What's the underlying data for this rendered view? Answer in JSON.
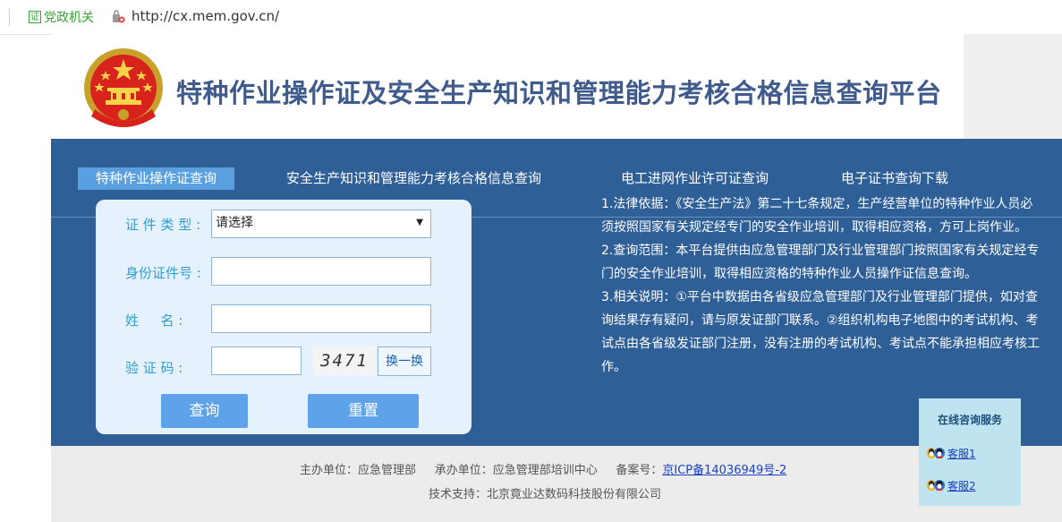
{
  "browser": {
    "badge_icon_char": "证",
    "badge_label": "党政机关",
    "url": "http://cx.mem.gov.cn/"
  },
  "header": {
    "title": "特种作业操作证及安全生产知识和管理能力考核合格信息查询平台"
  },
  "tabs": [
    {
      "label": "特种作业操作证查询",
      "active": true
    },
    {
      "label": "安全生产知识和管理能力考核合格信息查询",
      "active": false
    },
    {
      "label": "电工进网作业许可证查询",
      "active": false
    },
    {
      "label": "电子证书查询下载",
      "active": false
    }
  ],
  "form": {
    "cert_type_label": "证 件 类 型 :",
    "cert_type_value": "请选择",
    "id_label": "身份证件号 :",
    "id_value": "",
    "name_label": "姓 　 名 :",
    "name_value": "",
    "captcha_label": "验 证 码 :",
    "captcha_value": "",
    "captcha_image_text": "3471",
    "refresh_label": "换一换",
    "query_button": "查询",
    "reset_button": "重置"
  },
  "info": {
    "p1": "1.法律依据：《安全生产法》第二十七条规定，生产经营单位的特种作业人员必须按照国家有关规定经专门的安全作业培训，取得相应资格，方可上岗作业。",
    "p2": "2.查询范围：本平台提供由应急管理部门及行业管理部门按照国家有关规定经专门的安全作业培训，取得相应资格的特种作业人员操作证信息查询。",
    "p3": "3.相关说明：①平台中数据由各省级应急管理部门及行业管理部门提供，如对查询结果存有疑问，请与原发证部门联系。②组织机构电子地图中的考试机构、考试点由各省级发证部门注册，没有注册的考试机构、考试点不能承担相应考核工作。"
  },
  "footer": {
    "sponsor": "主办单位：应急管理部",
    "organizer": "承办单位：应急管理部培训中心",
    "icp_label": "备案号：",
    "icp_link": "京ICP备14036949号-2",
    "tech_support": "技术支持：北京竟业达数码科技股份有限公司"
  },
  "service": {
    "title": "在线咨询服务",
    "items": [
      "客服1",
      "客服2"
    ]
  },
  "colors": {
    "panel_blue": "#2f5f97",
    "tab_active": "#5aa0e0",
    "button_blue": "#5ea3e9",
    "title_blue": "#3f5b8c"
  }
}
